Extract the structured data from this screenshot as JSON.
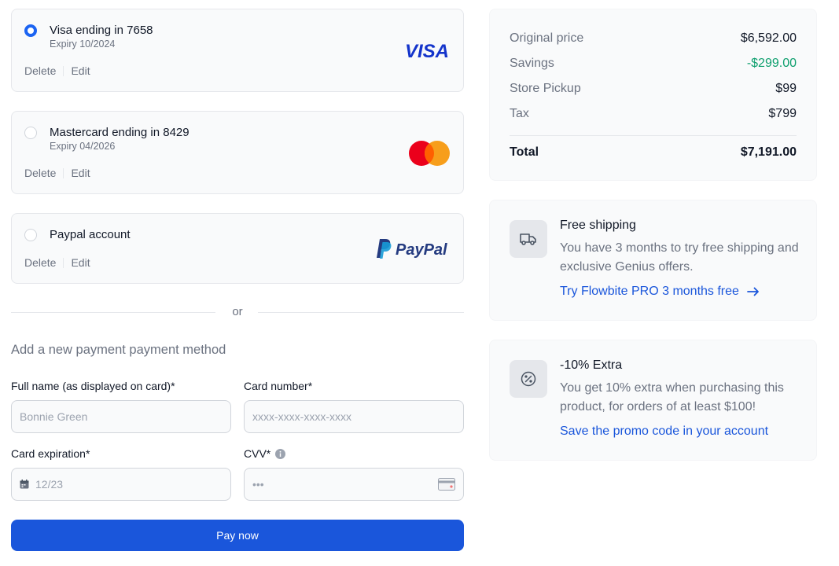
{
  "payment_methods": [
    {
      "title": "Visa ending in 7658",
      "expiry": "Expiry 10/2024",
      "selected": true,
      "brand": "VISA",
      "logo": "visa-logo"
    },
    {
      "title": "Mastercard ending in 8429",
      "expiry": "Expiry 04/2026",
      "selected": false,
      "logo": "mastercard-logo"
    },
    {
      "title": "Paypal account",
      "expiry": "",
      "selected": false,
      "brand": "PayPal",
      "logo": "paypal-logo"
    }
  ],
  "actions": {
    "delete": "Delete",
    "edit": "Edit"
  },
  "divider_text": "or",
  "new_method": {
    "heading": "Add a new payment payment method",
    "full_name_label": "Full name (as displayed on card)*",
    "full_name_placeholder": "Bonnie Green",
    "card_number_label": "Card number*",
    "card_number_placeholder": "xxxx-xxxx-xxxx-xxxx",
    "expiration_label": "Card expiration*",
    "expiration_placeholder": "12/23",
    "cvv_label": "CVV*",
    "cvv_placeholder": "•••",
    "pay_button": "Pay now"
  },
  "summary": {
    "rows": [
      {
        "label": "Original price",
        "value": "$6,592.00"
      },
      {
        "label": "Savings",
        "value": "-$299.00"
      },
      {
        "label": "Store Pickup",
        "value": "$99"
      },
      {
        "label": "Tax",
        "value": "$799"
      }
    ],
    "total_label": "Total",
    "total_value": "$7,191.00"
  },
  "promos": [
    {
      "icon": "truck-icon",
      "title": "Free shipping",
      "text": "You have 3 months to try free shipping and exclusive Genius offers.",
      "link": "Try Flowbite PRO 3 months free"
    },
    {
      "icon": "discount-badge-icon",
      "title": "-10% Extra",
      "text": "You get 10% extra when purchasing this product, for orders of at least $100!",
      "link": "Save the promo code in your account"
    }
  ],
  "colors": {
    "accent": "#1a56db",
    "savings": "#0e9f6e",
    "visa": "#1434cb",
    "paypal_dark": "#253b80",
    "paypal_light": "#179bd7",
    "mastercard_red": "#eb001b",
    "mastercard_orange": "#f79e1b"
  }
}
